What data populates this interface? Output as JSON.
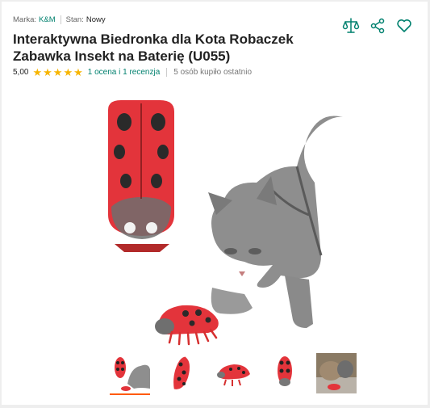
{
  "meta": {
    "brand_label": "Marka:",
    "brand_value": "K&M",
    "condition_label": "Stan:",
    "condition_value": "Nowy"
  },
  "actions": [
    {
      "name": "compare-icon"
    },
    {
      "name": "share-icon"
    },
    {
      "name": "heart-icon"
    }
  ],
  "product": {
    "title": "Interaktywna Biedronka dla Kota Robaczek Zabawka Insekt na Baterię (U055)"
  },
  "rating": {
    "score": "5,00",
    "stars": 5,
    "reviews_link": "1 ocena i 1 recenzja",
    "bought_text": "5 osób kupiło ostatnio"
  },
  "colors": {
    "accent": "#00806e",
    "star": "#f7b500",
    "active_thumb": "#ff5a00",
    "ladybug_red": "#e3343b"
  },
  "gallery": {
    "thumbnail_count": 5,
    "active_index": 0
  }
}
